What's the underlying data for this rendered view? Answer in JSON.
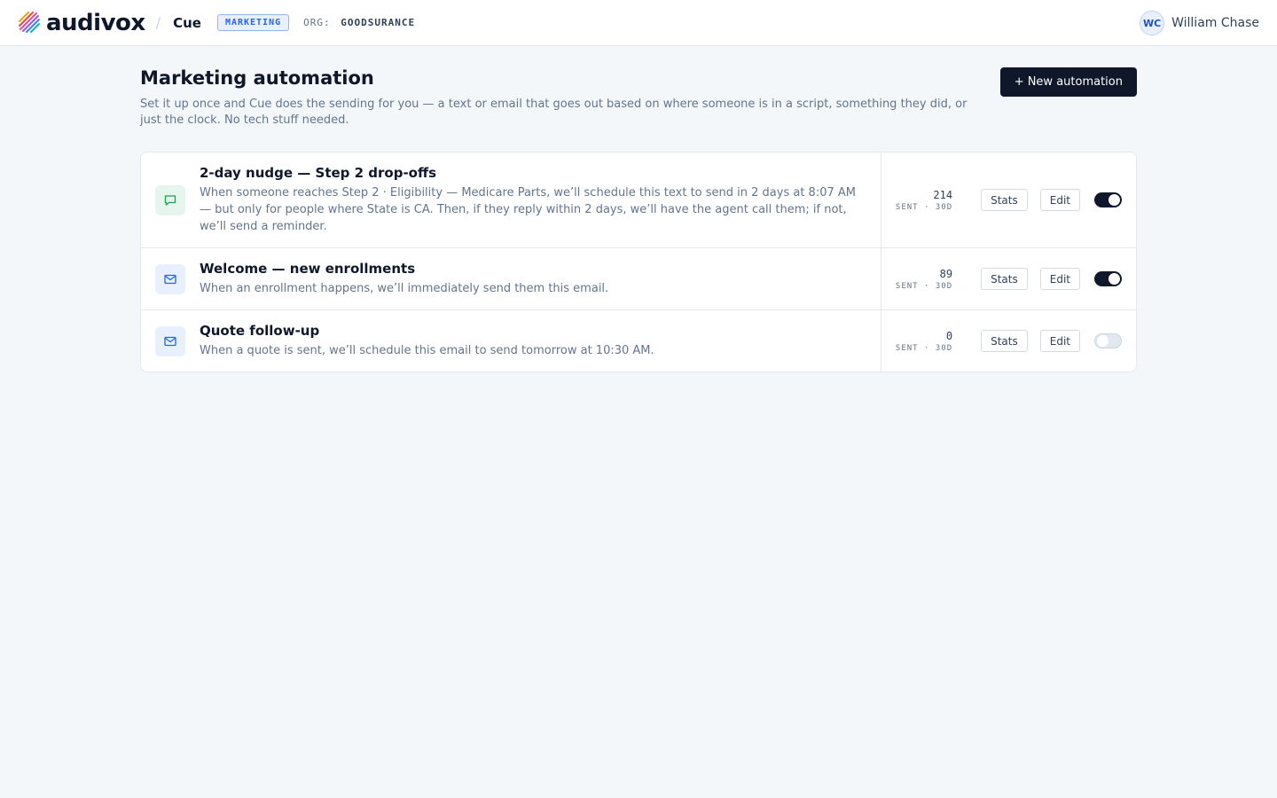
{
  "topbar": {
    "logo_text": "audivox",
    "product": "Cue",
    "section_badge": "MARKETING",
    "org_label": "ORG:",
    "org_name": "GOODSURANCE",
    "user": {
      "initials": "WC",
      "name": "William Chase"
    }
  },
  "page": {
    "title": "Marketing automation",
    "description": "Set it up once and Cue does the sending for you — a text or email that goes out based on where someone is in a script, something they did, or just the clock. No tech stuff needed.",
    "new_button": "+ New automation"
  },
  "automations": [
    {
      "channel": "sms",
      "icon": "chat-bubble-icon",
      "title": "2-day nudge — Step 2 drop-offs",
      "description": "When someone reaches Step 2 · Eligibility — Medicare Parts, we’ll schedule this text to send in 2 days at 8:07 AM — but only for people where State is CA. Then, if they reply within 2 days, we’ll have the agent call them; if not, we’ll send a reminder.",
      "sent": "214",
      "sent_label": "SENT · 30D",
      "stats_label": "Stats",
      "edit_label": "Edit",
      "enabled": true
    },
    {
      "channel": "email",
      "icon": "envelope-icon",
      "title": "Welcome — new enrollments",
      "description": "When an enrollment happens, we’ll immediately send them this email.",
      "sent": "89",
      "sent_label": "SENT · 30D",
      "stats_label": "Stats",
      "edit_label": "Edit",
      "enabled": true
    },
    {
      "channel": "email",
      "icon": "envelope-icon",
      "title": "Quote follow-up",
      "description": "When a quote is sent, we’ll schedule this email to send tomorrow at 10:30 AM.",
      "sent": "0",
      "sent_label": "SENT · 30D",
      "stats_label": "Stats",
      "edit_label": "Edit",
      "enabled": false
    }
  ],
  "colors": {
    "primary": "#0f172a",
    "accent_blue": "#2563eb",
    "sms_green": "#16a34a",
    "background": "#f4f7fa"
  }
}
